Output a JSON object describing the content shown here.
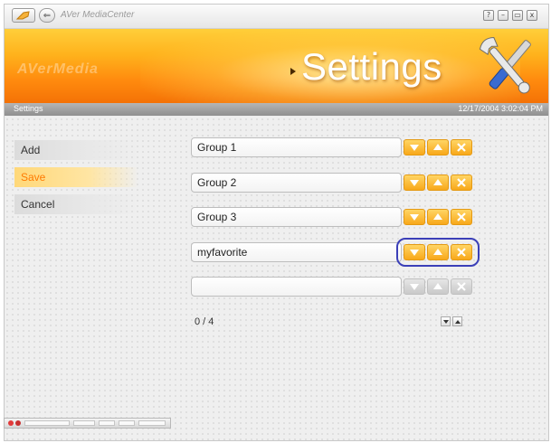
{
  "window": {
    "title": "AVer MediaCenter",
    "controls": {
      "help": "?",
      "minimize": "–",
      "restore": "▭",
      "close": "x"
    }
  },
  "banner": {
    "brand": "AVerMedia",
    "title": "Settings",
    "accent_color": "#ff9a10",
    "icon": "tools-icon"
  },
  "status": {
    "section": "Settings",
    "datetime": "12/17/2004 3:02:04 PM"
  },
  "menu": {
    "items": [
      {
        "label": "Add",
        "active": false
      },
      {
        "label": "Save",
        "active": true
      },
      {
        "label": "Cancel",
        "active": false
      }
    ]
  },
  "groups": [
    {
      "name": "Group 1",
      "enabled": true
    },
    {
      "name": "Group 2",
      "enabled": true
    },
    {
      "name": "Group 3",
      "enabled": true
    },
    {
      "name": "myfavorite",
      "enabled": true,
      "highlighted": true
    },
    {
      "name": "",
      "enabled": false
    }
  ],
  "row_buttons": [
    "move-down-icon",
    "move-up-icon",
    "delete-icon"
  ],
  "pager": {
    "text": "0 / 4",
    "buttons": [
      "page-down-icon",
      "page-up-icon"
    ]
  }
}
